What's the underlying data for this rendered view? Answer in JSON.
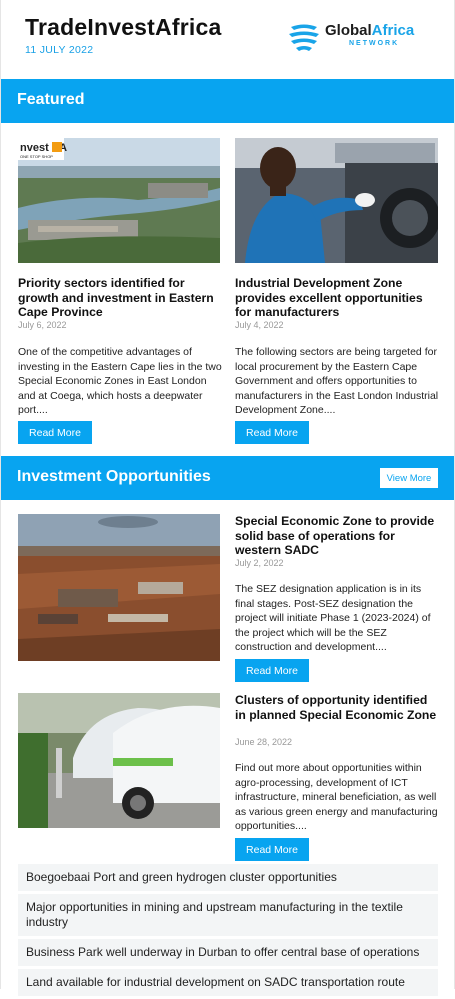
{
  "header": {
    "title": "TradeInvestAfrica",
    "date": "11 JULY 2022",
    "logo_main_1": "Global",
    "logo_main_2": "Africa",
    "logo_sub": "NETWORK"
  },
  "featured": {
    "section_title": "Featured",
    "articles": [
      {
        "title": "Priority sectors identified for growth and investment in Eastern Cape Province",
        "date": "July 6, 2022",
        "excerpt": "One of the competitive advantages of investing in the Eastern Cape lies in the two Special Economic Zones in East London and at Coega, which hosts a deepwater port....",
        "button": "Read More",
        "image_badge": "nvest SA",
        "image_badge_sub": "ONE STOP SHOP"
      },
      {
        "title": "Industrial Development Zone provides excellent opportunities for manufacturers",
        "date": "July 4, 2022",
        "excerpt": "The following sectors are being targeted for local procurement by the Eastern Cape Government and offers opportunities to manufacturers in the East London Industrial Development Zone....",
        "button": "Read More"
      }
    ]
  },
  "investment": {
    "section_title": "Investment Opportunities",
    "view_more": "View More",
    "articles": [
      {
        "title": "Special Economic Zone to provide solid base of operations for western SADC",
        "date": "July 2, 2022",
        "excerpt": "The SEZ designation application is in its final stages. Post-SEZ designation the project will initiate Phase 1 (2023-2024) of the project which will be the SEZ construction and development....",
        "button": "Read More"
      },
      {
        "title": "Clusters of opportunity identified in planned Special Economic Zone",
        "date": "June 28, 2022",
        "excerpt": "Find out more about opportunities within agro-processing, development of ICT infrastructure, mineral beneficiation, as well as various green energy and manufacturing opportunities....",
        "button": "Read More"
      }
    ],
    "links": [
      "Boegoebaai Port and green hydrogen cluster opportunities",
      "Major opportunities in mining and upstream manufacturing in the textile industry",
      "Business Park well underway in Durban to offer central base of operations",
      "Land available for industrial development on SADC transportation route"
    ]
  },
  "colors": {
    "accent": "#08a4f0",
    "title_text": "#111111",
    "date_text": "#999999"
  }
}
